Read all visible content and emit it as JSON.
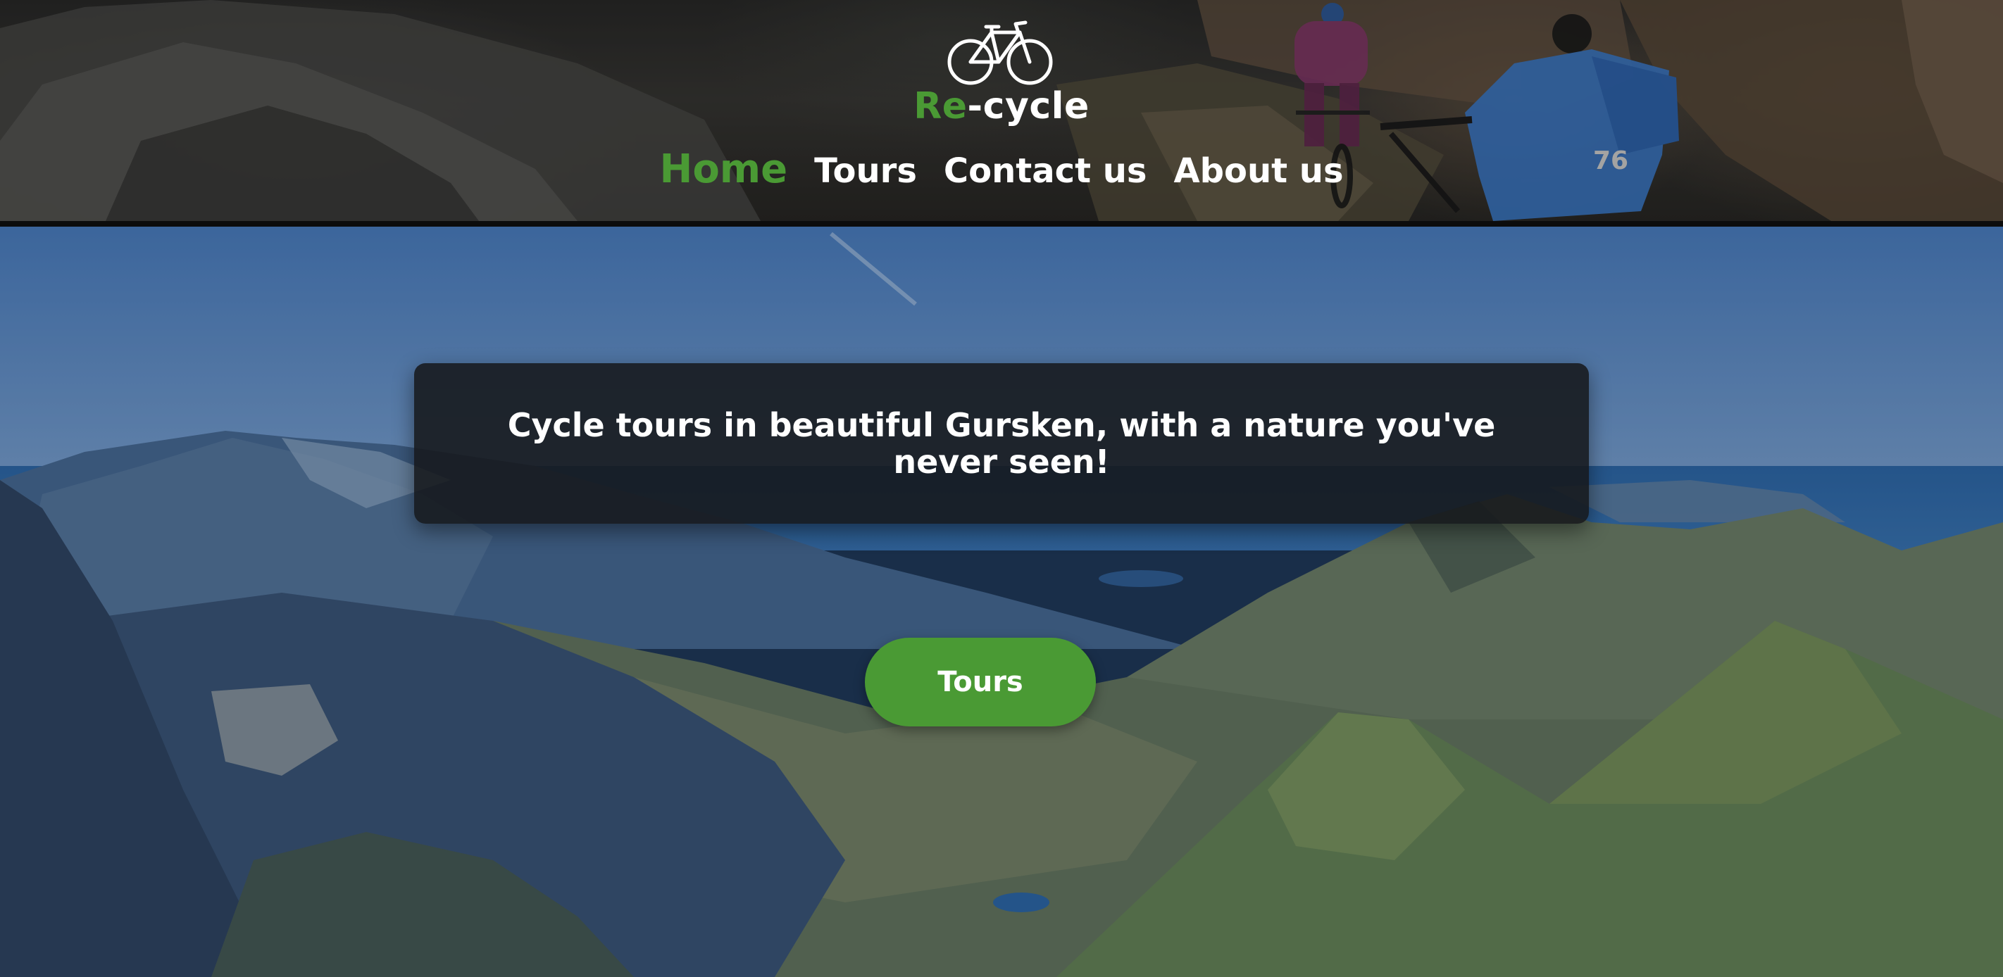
{
  "brand": {
    "prefix": "Re",
    "suffix": "-cycle",
    "accent_color": "#4a9a34",
    "icon": "bicycle-icon"
  },
  "nav": {
    "items": [
      {
        "label": "Home",
        "active": true
      },
      {
        "label": "Tours",
        "active": false
      },
      {
        "label": "Contact us",
        "active": false
      },
      {
        "label": "About us",
        "active": false
      }
    ]
  },
  "hero": {
    "tagline": "Cycle tours in beautiful Gursken, with a nature you've never seen!",
    "cta_label": "Tours"
  }
}
